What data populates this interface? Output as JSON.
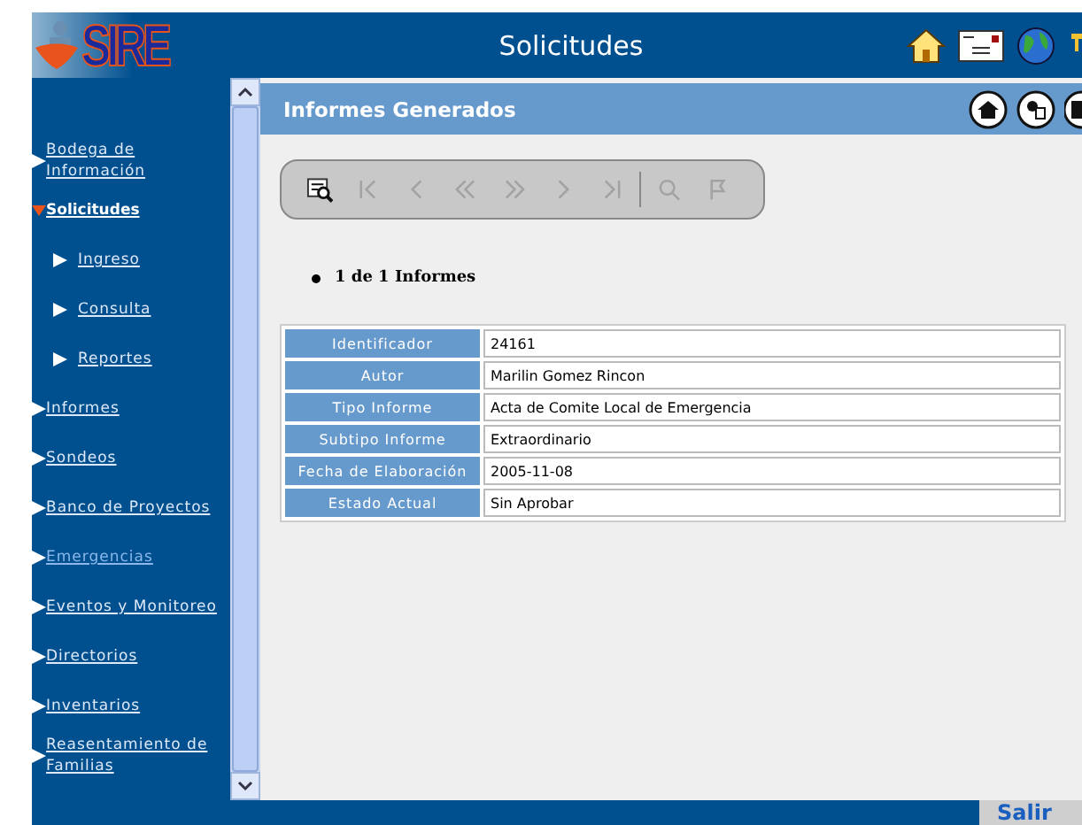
{
  "header": {
    "title": "Solicitudes",
    "logo": "SIRE"
  },
  "sidebar": {
    "items": [
      {
        "label": "Bodega de Información",
        "kind": "section",
        "expanded": false,
        "visited": false
      },
      {
        "label": "Solicitudes",
        "kind": "section",
        "expanded": true,
        "visited": false,
        "children": [
          {
            "label": "Ingreso",
            "visited": false
          },
          {
            "label": "Consulta",
            "visited": false
          },
          {
            "label": "Reportes",
            "visited": false
          }
        ]
      },
      {
        "label": "Informes",
        "kind": "section",
        "expanded": false,
        "visited": false
      },
      {
        "label": "Sondeos",
        "kind": "section",
        "expanded": false,
        "visited": false
      },
      {
        "label": "Banco de Proyectos",
        "kind": "section",
        "expanded": false,
        "visited": false
      },
      {
        "label": "Emergencias",
        "kind": "section",
        "expanded": false,
        "visited": true
      },
      {
        "label": "Eventos y Monitoreo",
        "kind": "section",
        "expanded": false,
        "visited": false
      },
      {
        "label": "Directorios",
        "kind": "section",
        "expanded": false,
        "visited": false
      },
      {
        "label": "Inventarios",
        "kind": "section",
        "expanded": false,
        "visited": false
      },
      {
        "label": "Reasentamiento de Familias",
        "kind": "section",
        "expanded": false,
        "visited": false
      }
    ]
  },
  "panel": {
    "title": "Informes Generados",
    "toolbar": [
      {
        "kind": "search",
        "disabled": false
      },
      {
        "kind": "first",
        "disabled": true
      },
      {
        "kind": "prev",
        "disabled": true
      },
      {
        "kind": "prev-page",
        "disabled": true
      },
      {
        "kind": "next-page",
        "disabled": true
      },
      {
        "kind": "next",
        "disabled": true
      },
      {
        "kind": "last",
        "disabled": true
      },
      {
        "kind": "zoom",
        "disabled": true
      },
      {
        "kind": "flag",
        "disabled": true
      }
    ],
    "count": "1 de 1 Informes",
    "rows": [
      {
        "label": "Identificador",
        "value": "24161"
      },
      {
        "label": "Autor",
        "value": "Marilin Gomez Rincon"
      },
      {
        "label": "Tipo Informe",
        "value": "Acta de Comite Local de Emergencia"
      },
      {
        "label": "Subtipo Informe",
        "value": "Extraordinario"
      },
      {
        "label": "Fecha de Elaboración",
        "value": "2005-11-08"
      },
      {
        "label": "Estado Actual",
        "value": "Sin Aprobar"
      }
    ]
  },
  "footer": {
    "button": "Salir"
  }
}
